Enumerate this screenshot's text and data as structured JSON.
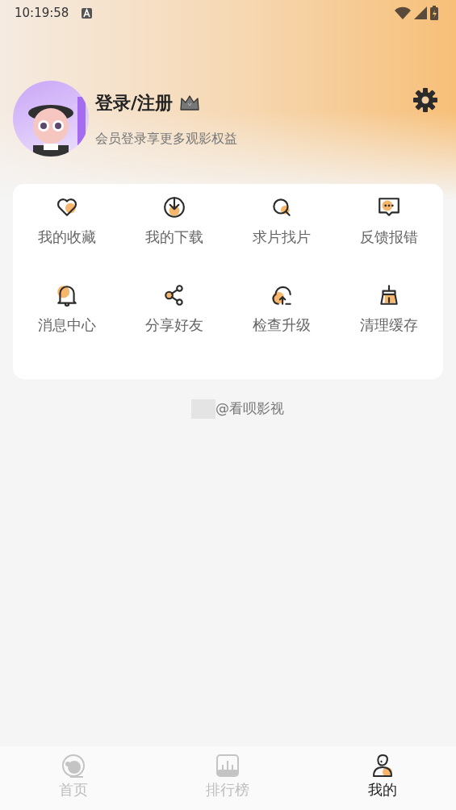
{
  "status_bar": {
    "time": "10:19:58"
  },
  "profile": {
    "title": "登录/注册",
    "subtitle": "会员登录享更多观影权益"
  },
  "menu": [
    {
      "label": "我的收藏",
      "kind": "heart"
    },
    {
      "label": "我的下载",
      "kind": "download"
    },
    {
      "label": "求片找片",
      "kind": "search"
    },
    {
      "label": "反馈报错",
      "kind": "feedback"
    },
    {
      "label": "消息中心",
      "kind": "bell"
    },
    {
      "label": "分享好友",
      "kind": "share"
    },
    {
      "label": "检查升级",
      "kind": "upgrade"
    },
    {
      "label": "清理缓存",
      "kind": "broom"
    }
  ],
  "footer": {
    "text": "@看呗影视"
  },
  "tab_bar": [
    {
      "label": "首页",
      "kind": "home",
      "selected": false
    },
    {
      "label": "排行榜",
      "kind": "chart",
      "selected": false
    },
    {
      "label": "我的",
      "kind": "person",
      "selected": true
    }
  ]
}
